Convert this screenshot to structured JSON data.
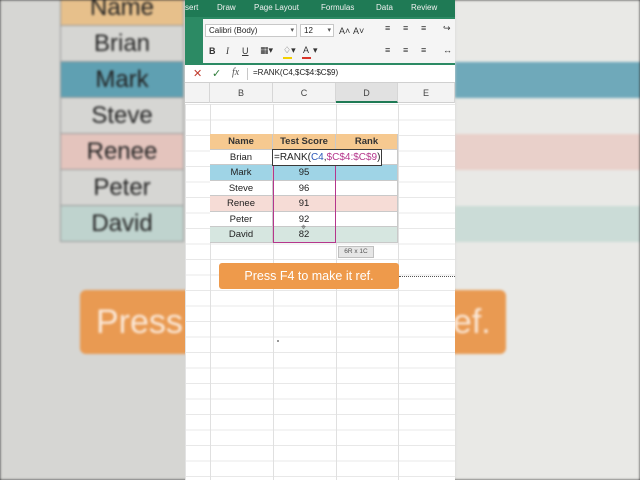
{
  "background": {
    "names": [
      "Name",
      "Brian",
      "Mark",
      "Steve",
      "Renee",
      "Peter",
      "David"
    ],
    "row_colors": [
      "#e7c08b",
      "#d6d6d3",
      "#5fa0b2",
      "#d6d6d3",
      "#e4c4bd",
      "#d6d6d3",
      "#bfd3ce"
    ],
    "press_left": "Press",
    "press_right": "ef."
  },
  "ribbon": {
    "tabs": [
      "sert",
      "Draw",
      "Page Layout",
      "Formulas",
      "Data",
      "Review"
    ],
    "font_name": "Calibri (Body)",
    "font_size": "12",
    "bold": "B",
    "italic": "I",
    "underline": "U",
    "grow_font": "A˄",
    "shrink_font": "A˅",
    "font_color": "A"
  },
  "formula_bar": {
    "cancel_icon": "x-icon",
    "enter_icon": "check-icon",
    "fx_label": "fx",
    "content": "=RANK(C4,$C$4:$C$9)"
  },
  "columns": [
    "B",
    "C",
    "D",
    "E"
  ],
  "table": {
    "headers": [
      "Name",
      "Test Score",
      "Rank"
    ],
    "rows": [
      {
        "name": "Brian",
        "score": "",
        "rank": "",
        "color": "#ffffff"
      },
      {
        "name": "Mark",
        "score": "95",
        "rank": "",
        "color": "#9fd4e6"
      },
      {
        "name": "Steve",
        "score": "96",
        "rank": "",
        "color": "#ffffff"
      },
      {
        "name": "Renee",
        "score": "91",
        "rank": "",
        "color": "#f6dcd6"
      },
      {
        "name": "Peter",
        "score": "92",
        "rank": "",
        "color": "#ffffff"
      },
      {
        "name": "David",
        "score": "82",
        "rank": "",
        "color": "#d6e6e0"
      }
    ]
  },
  "formula_parts": {
    "prefix": "=RANK(",
    "ref": "C4",
    "comma": ",",
    "range": "$C$4:$C$9",
    "suffix": ")"
  },
  "selection_tooltip": "6R x 1C",
  "caption": "Press F4 to make it ref."
}
